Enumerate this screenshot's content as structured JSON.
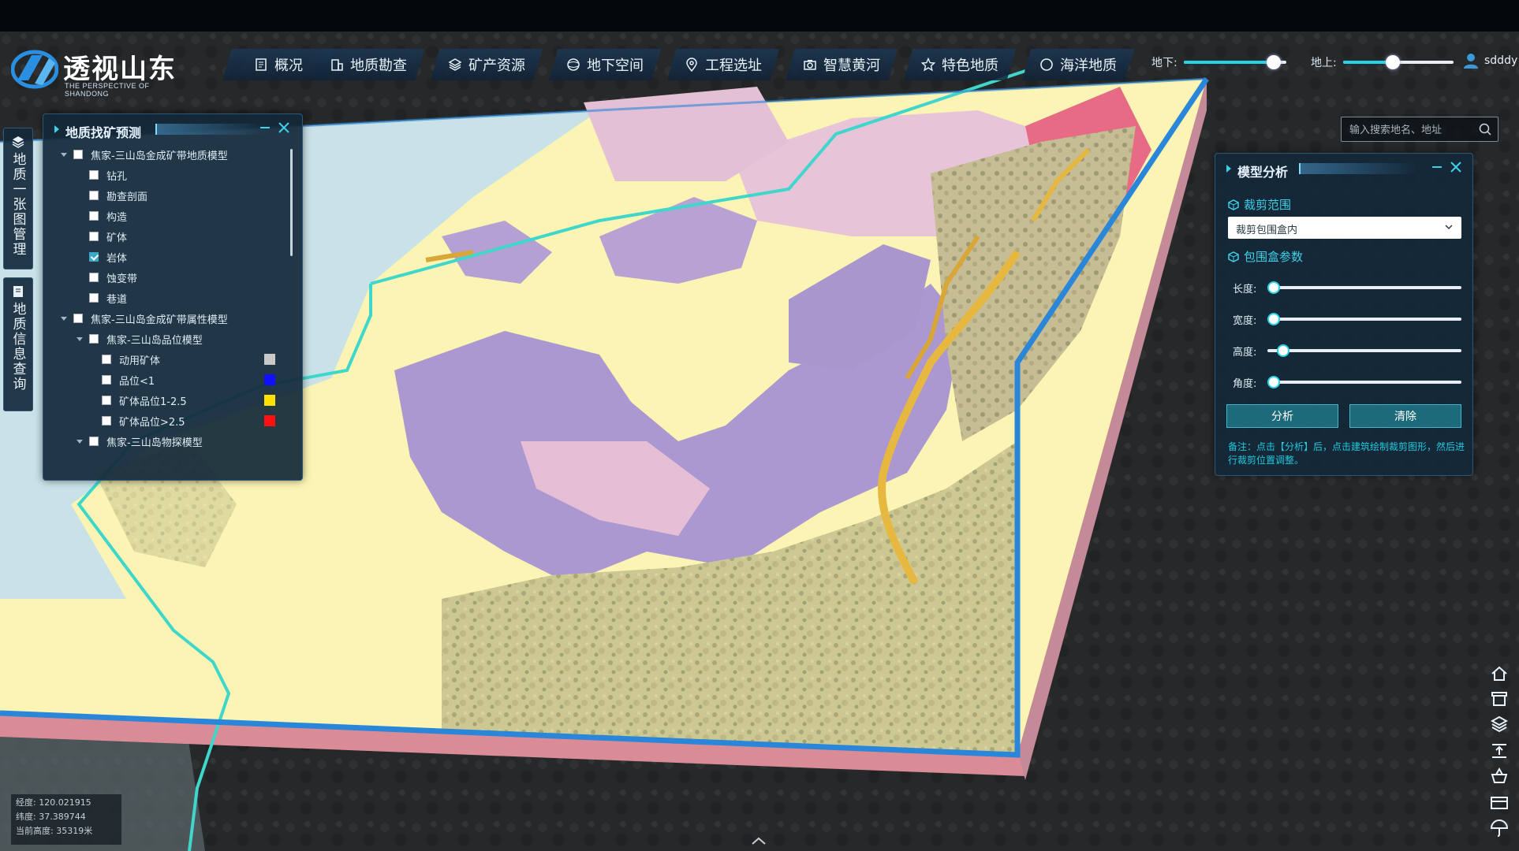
{
  "app": {
    "title": "透视山东",
    "subtitle": "THE PERSPECTIVE OF SHANDONG"
  },
  "nav": [
    {
      "label": "概况",
      "icon": "document-icon"
    },
    {
      "label": "地质勘查",
      "icon": "building-icon"
    },
    {
      "label": "矿产资源",
      "icon": "layers-icon"
    },
    {
      "label": "地下空间",
      "icon": "sphere-icon"
    },
    {
      "label": "工程选址",
      "icon": "location-pin-icon"
    },
    {
      "label": "智慧黄河",
      "icon": "camera-icon"
    },
    {
      "label": "特色地质",
      "icon": "star-icon"
    },
    {
      "label": "海洋地质",
      "icon": "ocean-icon"
    }
  ],
  "sliders": {
    "underground_label": "地下:",
    "underground_value": 0.88,
    "ground_label": "地上:",
    "ground_value": 0.45
  },
  "user": {
    "name": "sdddy"
  },
  "search": {
    "placeholder": "输入搜索地名、地址"
  },
  "left_tabs": [
    {
      "label": "地质一张图管理",
      "icon": "layers-icon"
    },
    {
      "label": "地质信息查询",
      "icon": "document-icon"
    }
  ],
  "layer_panel": {
    "title": "地质找矿预测",
    "items": [
      {
        "label": "焦家-三山岛金成矿带地质模型",
        "level": 0,
        "expanded": true,
        "checked": false
      },
      {
        "label": "钻孔",
        "level": 1,
        "checked": false
      },
      {
        "label": "勘查剖面",
        "level": 1,
        "checked": false
      },
      {
        "label": "构造",
        "level": 1,
        "checked": false
      },
      {
        "label": "矿体",
        "level": 1,
        "checked": false
      },
      {
        "label": "岩体",
        "level": 1,
        "checked": true
      },
      {
        "label": "蚀变带",
        "level": 1,
        "checked": false
      },
      {
        "label": "巷道",
        "level": 1,
        "checked": false
      },
      {
        "label": "焦家-三山岛金成矿带属性模型",
        "level": 0,
        "expanded": true,
        "checked": false
      },
      {
        "label": "焦家-三山岛品位模型",
        "level": 1,
        "expanded": true,
        "checked": false
      },
      {
        "label": "动用矿体",
        "level": 2,
        "checked": false,
        "swatch": "#c8c8c8"
      },
      {
        "label": "品位<1",
        "level": 2,
        "checked": false,
        "swatch": "#1010ff"
      },
      {
        "label": "矿体品位1-2.5",
        "level": 2,
        "checked": false,
        "swatch": "#ffe000"
      },
      {
        "label": "矿体品位>2.5",
        "level": 2,
        "checked": false,
        "swatch": "#ff1010"
      },
      {
        "label": "焦家-三山岛物探模型",
        "level": 1,
        "expanded": true,
        "checked": false
      }
    ]
  },
  "model_panel": {
    "title": "模型分析",
    "clip_section": "裁剪范围",
    "clip_option": "裁剪包围盒内",
    "bbox_section": "包围盒参数",
    "params": [
      {
        "label": "长度:",
        "value": 0.0
      },
      {
        "label": "宽度:",
        "value": 0.0
      },
      {
        "label": "高度:",
        "value": 0.05
      },
      {
        "label": "角度:",
        "value": 0.0
      }
    ],
    "analyze_button": "分析",
    "clear_button": "清除",
    "note": "备注：点击【分析】后，点击建筑绘制裁剪图形，然后进行裁剪位置调整。"
  },
  "coords": {
    "lon": "经度: 120.021915",
    "lat": "纬度: 37.389744",
    "height": "当前高度: 35319米"
  },
  "colors": {
    "accent": "#26d3e6",
    "panel_bg": "#12283a",
    "map_yellow": "#fbf4b4",
    "map_purple": "#ac98d0",
    "map_pink": "#e8c4d8",
    "map_sea": "#c8e2e8",
    "border_blue": "#2a86d8"
  }
}
